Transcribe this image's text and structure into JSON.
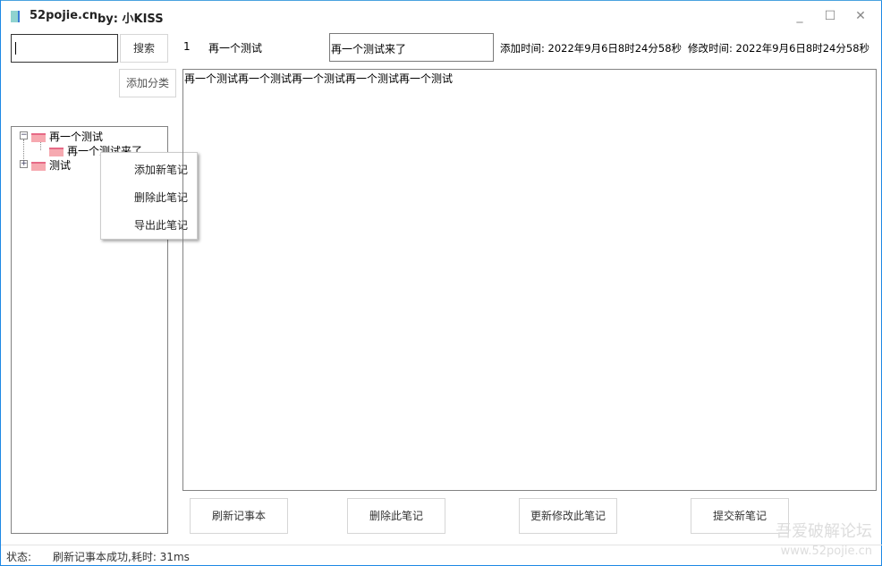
{
  "window": {
    "title": "52pojie.cn",
    "by": "by:  小KISS",
    "minimize": "_",
    "maximize": "☐",
    "close": "✕"
  },
  "search": {
    "value": "",
    "button": "搜索"
  },
  "add_category_button": "添加分类",
  "note": {
    "index": "1",
    "category": "再一个测试",
    "title": "再一个测试来了",
    "added": "添加时间: 2022年9月6日8时24分58秒",
    "modified": "修改时间: 2022年9月6日8时24分58秒",
    "content": "再一个测试再一个测试再一个测试再一个测试再一个测试"
  },
  "tree": {
    "nodes": [
      {
        "label": "再一个测试",
        "expander": "−",
        "children": [
          {
            "label": "再一个测试来了"
          }
        ]
      },
      {
        "label": "测试",
        "expander": "+"
      }
    ]
  },
  "context_menu": [
    "添加新笔记",
    "删除此笔记",
    "导出此笔记"
  ],
  "buttons": {
    "refresh": "刷新记事本",
    "delete": "删除此笔记",
    "update": "更新修改此笔记",
    "submit": "提交新笔记"
  },
  "status": {
    "label": "状态:",
    "text": "刷新记事本成功,耗时: 31ms"
  },
  "watermark": {
    "line1": "吾爱破解论坛",
    "line2": "www.52pojie.cn"
  }
}
